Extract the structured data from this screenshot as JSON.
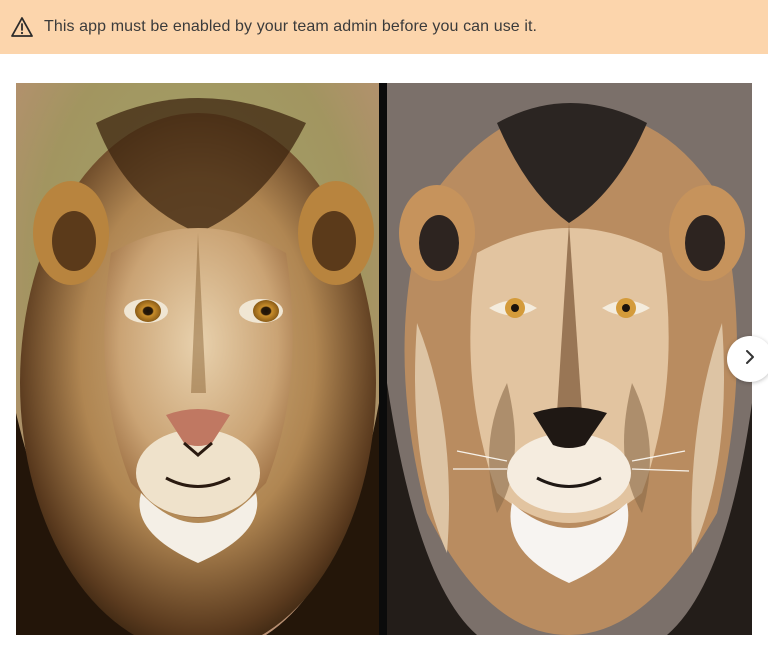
{
  "banner": {
    "icon": "warning-icon",
    "message": "This app must be enabled by your team admin before you can use it.",
    "background": "#fcd5ac"
  },
  "carousel": {
    "images": [
      {
        "name": "lion-photo",
        "style": "photograph"
      },
      {
        "name": "lion-illustration",
        "style": "digital painting"
      }
    ],
    "next_icon": "chevron-right-icon"
  }
}
